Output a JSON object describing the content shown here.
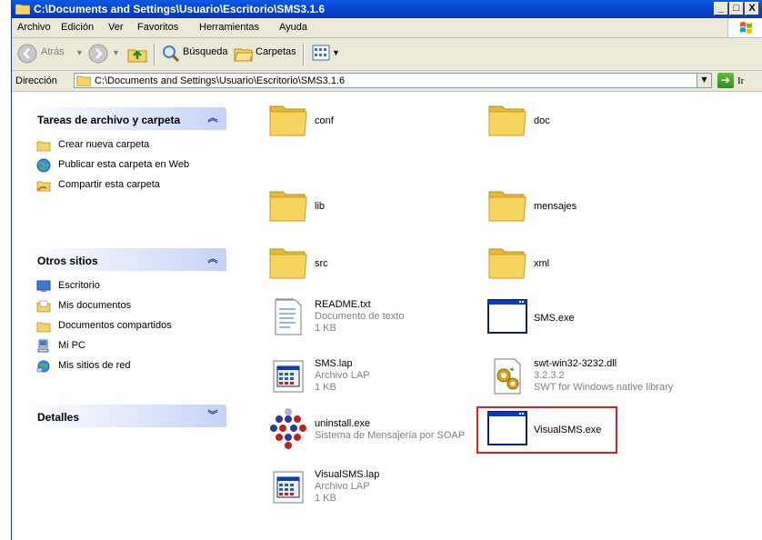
{
  "window": {
    "title": "C:\\Documents and Settings\\Usuario\\Escritorio\\SMS3.1.6",
    "buttons": {
      "minimize": "_",
      "maximize": "□",
      "close": "X"
    }
  },
  "menubar": {
    "items": [
      {
        "label": "Archivo"
      },
      {
        "label": "Edición"
      },
      {
        "label": "Ver"
      },
      {
        "label": "Favoritos"
      },
      {
        "label": "Herramientas"
      },
      {
        "label": "Ayuda"
      }
    ]
  },
  "toolbar": {
    "back_label": "Atrás",
    "search_label": "Búsqueda",
    "folders_label": "Carpetas"
  },
  "address": {
    "label": "Dirección",
    "value": "C:\\Documents and Settings\\Usuario\\Escritorio\\SMS3.1.6",
    "go_label": "Ir"
  },
  "panels": {
    "tasks": {
      "title": "Tareas de archivo y carpeta",
      "items": [
        {
          "label": "Crear nueva carpeta",
          "icon": "new-folder-icon"
        },
        {
          "label": "Publicar esta carpeta en Web",
          "icon": "publish-web-icon"
        },
        {
          "label": "Compartir esta carpeta",
          "icon": "share-folder-icon"
        }
      ]
    },
    "places": {
      "title": "Otros sitios",
      "items": [
        {
          "label": "Escritorio",
          "icon": "desktop-icon"
        },
        {
          "label": "Mis documentos",
          "icon": "my-documents-icon"
        },
        {
          "label": "Documentos compartidos",
          "icon": "shared-documents-icon"
        },
        {
          "label": "Mi PC",
          "icon": "my-computer-icon"
        },
        {
          "label": "Mis sitios de red",
          "icon": "network-places-icon"
        }
      ]
    },
    "details": {
      "title": "Detalles"
    }
  },
  "files": [
    {
      "name": "conf",
      "type": "folder"
    },
    {
      "name": "doc",
      "type": "folder"
    },
    {
      "name": "lib",
      "type": "folder"
    },
    {
      "name": "mensajes",
      "type": "folder"
    },
    {
      "name": "src",
      "type": "folder"
    },
    {
      "name": "xml",
      "type": "folder"
    },
    {
      "name": "README.txt",
      "type": "text",
      "desc": "Documento de texto",
      "size": "1 KB"
    },
    {
      "name": "SMS.exe",
      "type": "exe"
    },
    {
      "name": "SMS.lap",
      "type": "lap",
      "desc": "Archivo LAP",
      "size": "1 KB"
    },
    {
      "name": "swt-win32-3232.dll",
      "type": "dll",
      "desc": "3.2.3.2",
      "size": "SWT for Windows native library"
    },
    {
      "name": "uninstall.exe",
      "type": "uninstall",
      "desc": "Sistema de Mensajería por SOAP"
    },
    {
      "name": "VisualSMS.exe",
      "type": "exe",
      "highlighted": true
    },
    {
      "name": "VisualSMS.lap",
      "type": "lap",
      "desc": "Archivo LAP",
      "size": "1 KB"
    }
  ],
  "colors": {
    "titlebar": "#0a5ae6",
    "chrome": "#ece9d8",
    "folder": "#f7d45e",
    "highlight": "#e02020"
  }
}
